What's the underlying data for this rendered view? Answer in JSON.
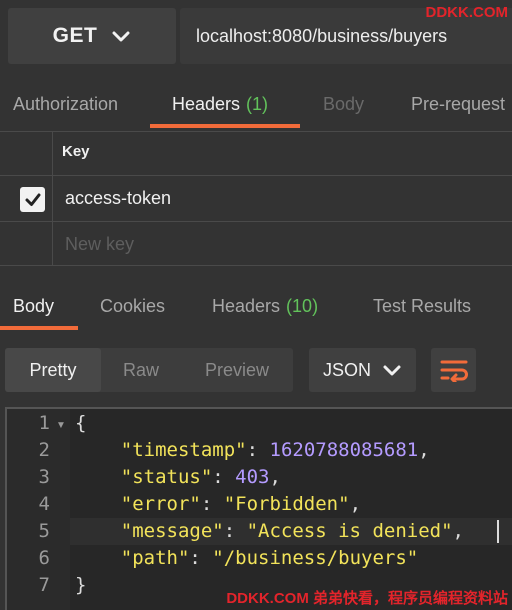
{
  "request": {
    "method": "GET",
    "url": "localhost:8080/business/buyers"
  },
  "watermark_top": "DDKK.COM",
  "watermark_bottom": "DDKK.COM 弟弟快看，程序员编程资料站",
  "request_tabs": {
    "authorization": "Authorization",
    "headers": "Headers",
    "headers_count": "(1)",
    "body": "Body",
    "pre_request": "Pre-request"
  },
  "headers_table": {
    "key_header": "Key",
    "rows": [
      {
        "checked": true,
        "key": "access-token"
      }
    ],
    "new_key_placeholder": "New key"
  },
  "response_tabs": {
    "body": "Body",
    "cookies": "Cookies",
    "headers": "Headers",
    "headers_count": "(10)",
    "test_results": "Test Results"
  },
  "view_modes": {
    "pretty": "Pretty",
    "raw": "Raw",
    "preview": "Preview"
  },
  "format_select": "JSON",
  "code": {
    "line_numbers": [
      "1",
      "2",
      "3",
      "4",
      "5",
      "6",
      "7"
    ],
    "open_brace": "{",
    "close_brace": "}",
    "fields": [
      {
        "key": "\"timestamp\"",
        "value": "1620788085681",
        "type": "number",
        "comma": ","
      },
      {
        "key": "\"status\"",
        "value": "403",
        "type": "number",
        "comma": ","
      },
      {
        "key": "\"error\"",
        "value": "\"Forbidden\"",
        "type": "string",
        "comma": ","
      },
      {
        "key": "\"message\"",
        "value": "\"Access is denied\"",
        "type": "string",
        "comma": ","
      },
      {
        "key": "\"path\"",
        "value": "\"/business/buyers\"",
        "type": "string",
        "comma": ""
      }
    ]
  },
  "colors": {
    "accent": "#f26b3a",
    "count_green": "#62c25b",
    "json_key": "#f2e35a",
    "json_number": "#b49bff",
    "watermark": "#e3242b"
  },
  "icons": {
    "method_dropdown": "chevron-down-icon",
    "format_dropdown": "chevron-down-icon",
    "wrap": "wrap-lines-icon",
    "checkbox": "checkmark-icon",
    "fold": "fold-arrow-icon"
  }
}
